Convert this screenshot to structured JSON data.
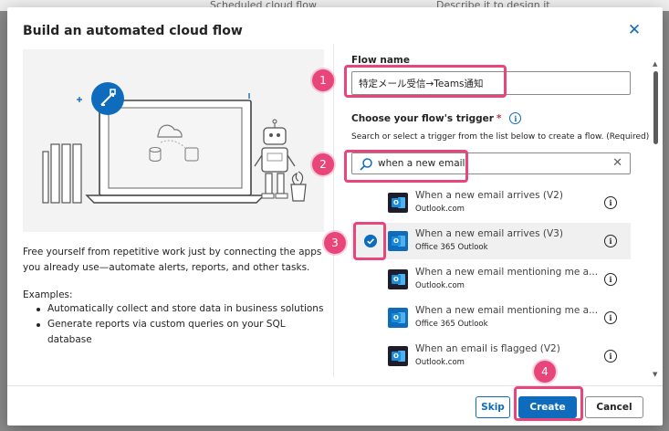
{
  "background": {
    "left_text": "Scheduled cloud flow",
    "right_text": "Describe it to design it"
  },
  "dialog": {
    "title": "Build an automated cloud flow",
    "close_label": "✕",
    "description": "Free yourself from repetitive work just by connecting the apps you already use—automate alerts, reports, and other tasks.",
    "examples_label": "Examples:",
    "examples": [
      "Automatically collect and store data in business solutions",
      "Generate reports via custom queries on your SQL database"
    ]
  },
  "form": {
    "flow_name_label": "Flow name",
    "flow_name_value": "特定メール受信→Teams通知",
    "trigger_label": "Choose your flow's trigger",
    "required_mark": "*",
    "trigger_help": "Search or select a trigger from the list below to create a flow. (Required)",
    "search_value": "when a new email",
    "search_clear": "✕"
  },
  "triggers": [
    {
      "name": "When a new email arrives (V2)",
      "connector": "Outlook.com",
      "selected": false,
      "icon": "outlook-com-icon"
    },
    {
      "name": "When a new email arrives (V3)",
      "connector": "Office 365 Outlook",
      "selected": true,
      "icon": "office365-outlook-icon"
    },
    {
      "name": "When a new email mentioning me a...",
      "connector": "Outlook.com",
      "selected": false,
      "icon": "outlook-com-icon"
    },
    {
      "name": "When a new email mentioning me a...",
      "connector": "Office 365 Outlook",
      "selected": false,
      "icon": "office365-outlook-icon"
    },
    {
      "name": "When an email is flagged (V2)",
      "connector": "Outlook.com",
      "selected": false,
      "icon": "outlook-com-icon"
    }
  ],
  "footer": {
    "skip": "Skip",
    "create": "Create",
    "cancel": "Cancel"
  },
  "callouts": [
    "1",
    "2",
    "3",
    "4"
  ],
  "colors": {
    "accent": "#0f6cbd",
    "callout": "#e8457a"
  }
}
